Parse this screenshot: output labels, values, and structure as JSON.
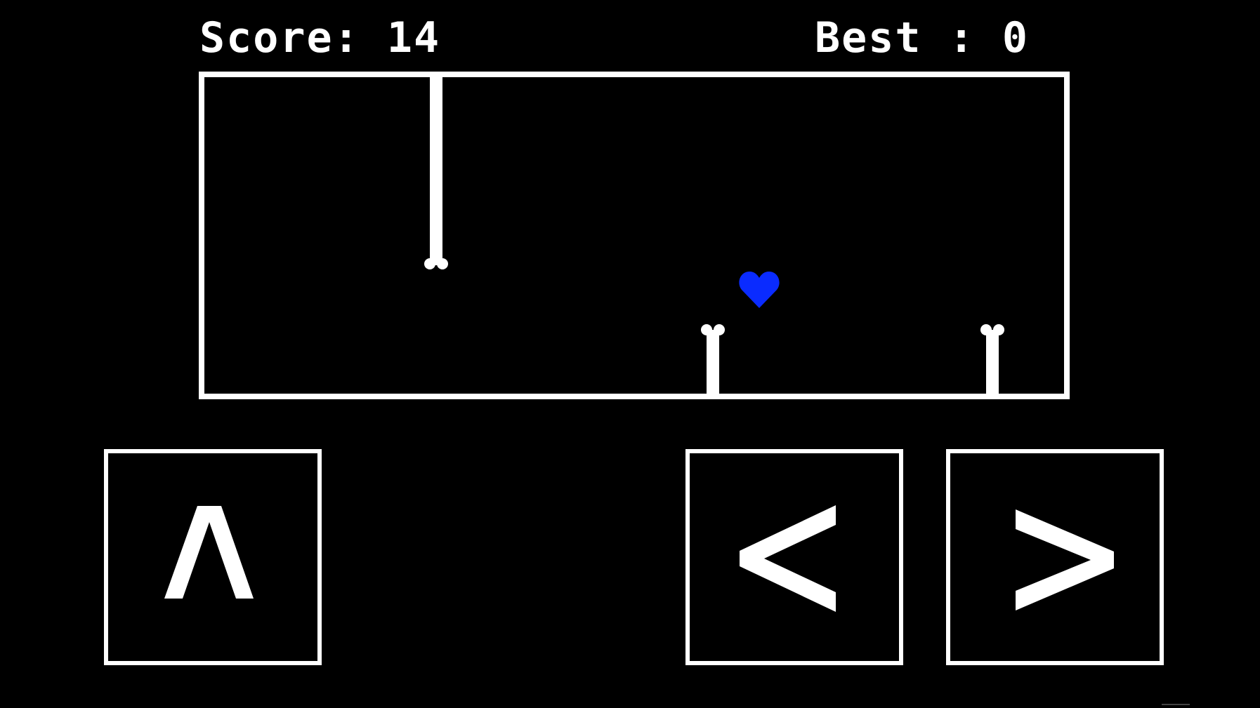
{
  "hud": {
    "score_text": "Score: 14",
    "best_text": "Best : 0"
  },
  "arena": {
    "bones": [
      {
        "name": "bone-top-hanging",
        "from": "top"
      },
      {
        "name": "bone-bottom-1",
        "from": "bottom"
      },
      {
        "name": "bone-bottom-2",
        "from": "bottom"
      }
    ],
    "soul": {
      "icon": "heart-icon",
      "color": "#0a2bff"
    }
  },
  "controls": {
    "up": {
      "label": "^",
      "icon": "chevron-up-icon"
    },
    "left": {
      "label": "<",
      "icon": "chevron-left-icon"
    },
    "right": {
      "label": ">",
      "icon": "chevron-right-icon"
    }
  },
  "colors": {
    "background": "#000000",
    "foreground": "#ffffff",
    "soul": "#0a2bff"
  }
}
